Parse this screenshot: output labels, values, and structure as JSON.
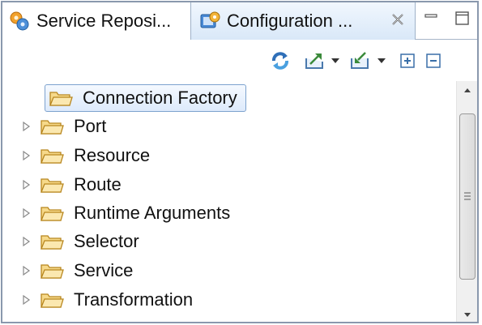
{
  "tabs": [
    {
      "label": "Service Reposi...",
      "icon": "service-repository-icon",
      "active": false
    },
    {
      "label": "Configuration ...",
      "icon": "configuration-icon",
      "active": true,
      "close_glyph": "✕"
    }
  ],
  "window_controls": {
    "minimize": "minimize-icon",
    "maximize": "maximize-icon"
  },
  "toolbar": {
    "items": [
      "refresh-icon",
      "export-icon",
      "export-dropdown-icon",
      "import-icon",
      "import-dropdown-icon",
      "expand-all-icon",
      "collapse-all-icon"
    ]
  },
  "tree": {
    "items": [
      {
        "label": "Connection Factory",
        "selected": true,
        "expandable": false
      },
      {
        "label": "Port",
        "selected": false,
        "expandable": true
      },
      {
        "label": "Resource",
        "selected": false,
        "expandable": true
      },
      {
        "label": "Route",
        "selected": false,
        "expandable": true
      },
      {
        "label": "Runtime Arguments",
        "selected": false,
        "expandable": true
      },
      {
        "label": "Selector",
        "selected": false,
        "expandable": true
      },
      {
        "label": "Service",
        "selected": false,
        "expandable": true
      },
      {
        "label": "Transformation",
        "selected": false,
        "expandable": true
      }
    ]
  },
  "colors": {
    "folder_fill": "#f6d98a",
    "folder_stroke": "#b8861e",
    "selection_border": "#7da2ce",
    "frame_border": "#8a98ad"
  }
}
